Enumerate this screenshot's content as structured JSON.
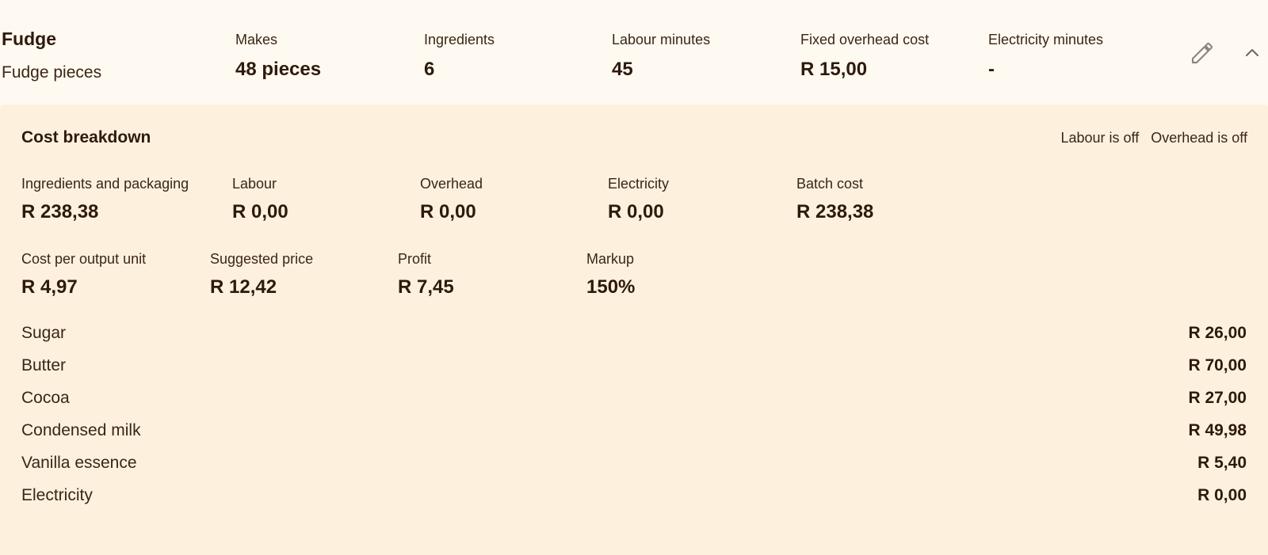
{
  "recipe": {
    "name": "Fudge",
    "subtitle": "Fudge pieces"
  },
  "stats": [
    {
      "label": "Makes",
      "value": "48 pieces"
    },
    {
      "label": "Ingredients",
      "value": "6"
    },
    {
      "label": "Labour minutes",
      "value": "45"
    },
    {
      "label": "Fixed overhead cost",
      "value": "R 15,00"
    },
    {
      "label": "Electricity minutes",
      "value": "-"
    }
  ],
  "actions": {
    "edit_icon": "pencil-icon",
    "collapse_icon": "chevron-up-icon"
  },
  "breakdown": {
    "title": "Cost breakdown",
    "labour_toggle": "Labour is off",
    "overhead_toggle": "Overhead is off",
    "row1": [
      {
        "label": "Ingredients and packaging",
        "value": "R 238,38"
      },
      {
        "label": "Labour",
        "value": "R 0,00"
      },
      {
        "label": "Overhead",
        "value": "R 0,00"
      },
      {
        "label": "Electricity",
        "value": "R 0,00"
      },
      {
        "label": "Batch cost",
        "value": "R 238,38"
      }
    ],
    "row2": [
      {
        "label": "Cost per output unit",
        "value": "R 4,97"
      },
      {
        "label": "Suggested price",
        "value": "R 12,42"
      },
      {
        "label": "Profit",
        "value": "R 7,45"
      },
      {
        "label": "Markup",
        "value": "150%"
      }
    ],
    "items": [
      {
        "name": "Sugar",
        "cost": "R 26,00"
      },
      {
        "name": "Butter",
        "cost": "R 70,00"
      },
      {
        "name": "Cocoa",
        "cost": "R 27,00"
      },
      {
        "name": "Condensed milk",
        "cost": "R 49,98"
      },
      {
        "name": "Vanilla essence",
        "cost": "R 5,40"
      },
      {
        "name": "Electricity",
        "cost": "R 0,00"
      }
    ]
  }
}
